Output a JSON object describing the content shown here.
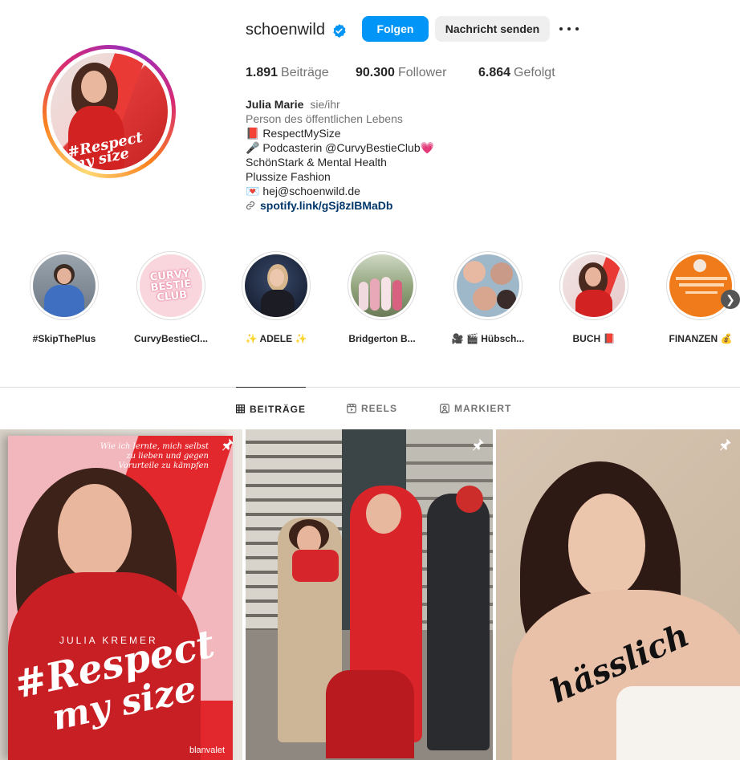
{
  "profile": {
    "username": "schoenwild",
    "follow_label": "Folgen",
    "message_label": "Nachricht senden",
    "stats": [
      {
        "value": "1.891",
        "label": "Beiträge"
      },
      {
        "value": "90.300",
        "label": "Follower"
      },
      {
        "value": "6.864",
        "label": "Gefolgt"
      }
    ],
    "name": "Julia Marie",
    "pronouns": "sie/ihr",
    "category": "Person des öffentlichen Lebens",
    "bio_lines": [
      "📕 RespectMySize",
      "🎤 Podcasterin @CurvyBestieClub💗",
      "SchönStark & Mental Health",
      "Plussize Fashion",
      "💌 hej@schoenwild.de"
    ],
    "link": "spotify.link/gSj8zIBMaDb",
    "avatar_text": "#Respect my size"
  },
  "highlights": [
    {
      "label": "#SkipThePlus"
    },
    {
      "label": "CurvyBestieCl...",
      "image_text": "CURVY BESTIE CLUB"
    },
    {
      "label": "✨ ADELE ✨"
    },
    {
      "label": "Bridgerton B..."
    },
    {
      "label": "🎥 🎬 Hübsch..."
    },
    {
      "label": "BUCH 📕"
    },
    {
      "label": "FINANZEN 💰"
    }
  ],
  "tabs": [
    {
      "label": "BEITRÄGE",
      "icon": "grid-icon",
      "active": true
    },
    {
      "label": "REELS",
      "icon": "reels-icon",
      "active": false
    },
    {
      "label": "MARKIERT",
      "icon": "tagged-icon",
      "active": false
    }
  ],
  "posts": [
    {
      "book_author": "JULIA KREMER",
      "book_title_1": "#Respect",
      "book_title_2": "my size",
      "tagline": "Wie ich lernte, mich selbst zu lieben und gegen Vorurteile zu kämpfen",
      "publisher": "blanvalet"
    },
    {},
    {
      "body_text": "hässlich"
    }
  ],
  "colors": {
    "accent": "#0095f6",
    "text": "#262626",
    "muted": "#737373",
    "link": "#00376b"
  }
}
